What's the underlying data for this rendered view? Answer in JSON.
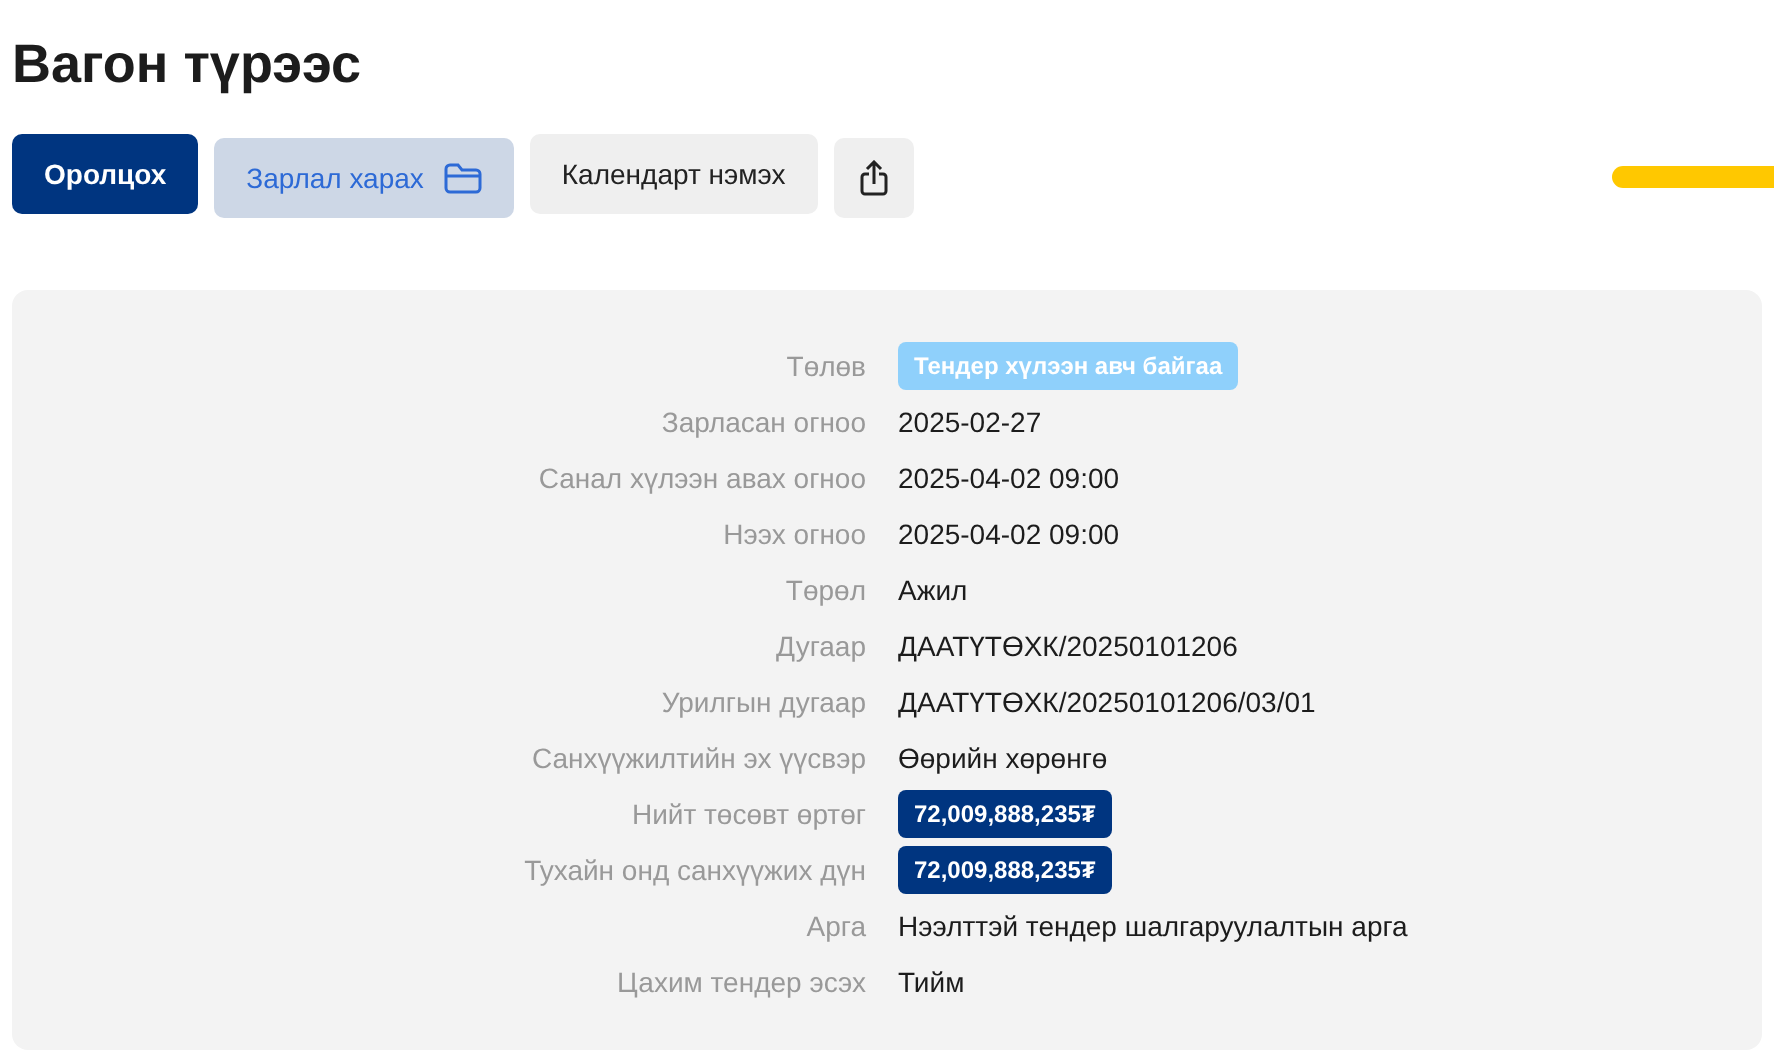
{
  "title": "Вагон түрээс",
  "actions": [
    {
      "label": "Оролцох",
      "kind": "primary"
    },
    {
      "label": "Зарлал харах",
      "kind": "secondary"
    },
    {
      "label": "Календарт нэмэх",
      "kind": "plain"
    },
    {
      "kind": "share"
    }
  ],
  "details": [
    {
      "label": "Төлөв",
      "value": "Тендер хүлээн авч байгаа",
      "kind": "status"
    },
    {
      "label": "Зарласан огноо",
      "value": "2025-02-27",
      "kind": "text"
    },
    {
      "label": "Санал хүлээн авах огноо",
      "value": "2025-04-02 09:00",
      "kind": "text"
    },
    {
      "label": "Нээх огноо",
      "value": "2025-04-02 09:00",
      "kind": "text"
    },
    {
      "label": "Төрөл",
      "value": "Ажил",
      "kind": "text"
    },
    {
      "label": "Дугаар",
      "value": "ДААТҮТӨХК/20250101206",
      "kind": "text"
    },
    {
      "label": "Урилгын дугаар",
      "value": "ДААТҮТӨХК/20250101206/03/01",
      "kind": "text"
    },
    {
      "label": "Санхүүжилтийн эх үүсвэр",
      "value": "Өөрийн хөрөнгө",
      "kind": "text"
    },
    {
      "label": "Нийт төсөвт өртөг",
      "value": "72,009,888,235₮",
      "kind": "amount"
    },
    {
      "label": "Тухайн онд санхүүжих дүн",
      "value": "72,009,888,235₮",
      "kind": "amount"
    },
    {
      "label": "Арга",
      "value": "Нээлттэй тендер шалгаруулалтын арга",
      "kind": "text"
    },
    {
      "label": "Цахим тендер эсэх",
      "value": "Тийм",
      "kind": "text"
    }
  ]
}
